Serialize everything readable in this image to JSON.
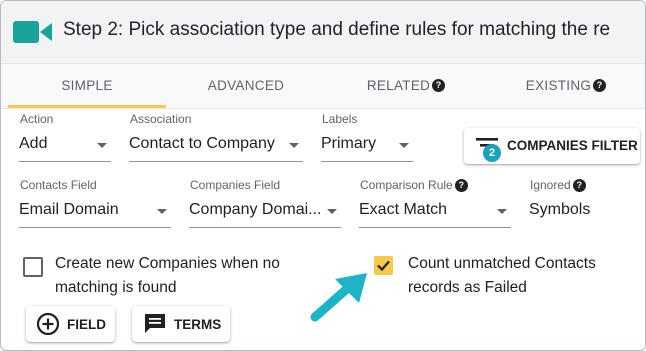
{
  "header": {
    "title": "Step 2: Pick association type and define rules for matching the re",
    "icon": "video-camera-icon",
    "icon_color": "#1aa39a"
  },
  "tabs": [
    {
      "label": "Simple",
      "active": true
    },
    {
      "label": "Advanced",
      "active": false
    },
    {
      "label": "Related",
      "active": false,
      "help": "?"
    },
    {
      "label": "Existing",
      "active": false,
      "help": "?"
    }
  ],
  "row1": {
    "action": {
      "label": "Action",
      "value": "Add"
    },
    "association": {
      "label": "Association",
      "value": "Contact to Company"
    },
    "labels": {
      "label": "Labels",
      "value": "Primary"
    },
    "filter_button": {
      "label": "Companies filter",
      "badge": "2"
    }
  },
  "row2": {
    "contacts_field": {
      "label": "Contacts Field",
      "value": "Email Domain"
    },
    "companies_field": {
      "label": "Companies Field",
      "value": "Company Domai..."
    },
    "comparison_rule": {
      "label": "Comparison Rule",
      "value": "Exact Match",
      "help": "?"
    },
    "ignored": {
      "label": "Ignored",
      "value": "Symbols",
      "help": "?"
    }
  },
  "options": {
    "create_new": {
      "label_line1": "Create new Companies when no",
      "label_line2": "matching is found",
      "checked": false
    },
    "count_unmatched": {
      "label_line1": "Count unmatched Contacts",
      "label_line2": "records as Failed",
      "checked": true
    }
  },
  "buttons": {
    "field": "Field",
    "terms": "Terms"
  },
  "colors": {
    "accent": "#f6c94a",
    "teal": "#1aa3b8",
    "arrow": "#1eb4c7"
  }
}
